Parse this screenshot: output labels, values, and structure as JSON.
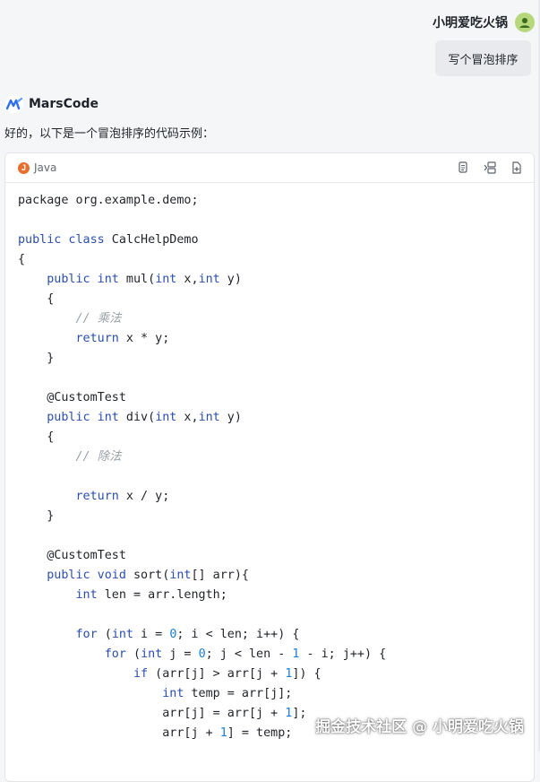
{
  "user": {
    "name": "小明爱吃火锅",
    "message": "写个冒泡排序"
  },
  "bot": {
    "name": "MarsCode",
    "intro": "好的，以下是一个冒泡排序的代码示例："
  },
  "code_block": {
    "language": "Java",
    "lines": [
      [
        {
          "t": "package org.example.demo;",
          "c": ""
        }
      ],
      [],
      [
        {
          "t": "public class",
          "c": "kw"
        },
        {
          "t": " CalcHelpDemo",
          "c": ""
        }
      ],
      [
        {
          "t": "{",
          "c": ""
        }
      ],
      [
        {
          "t": "    ",
          "c": ""
        },
        {
          "t": "public int",
          "c": "kw"
        },
        {
          "t": " mul(",
          "c": ""
        },
        {
          "t": "int",
          "c": "kw"
        },
        {
          "t": " x,",
          "c": ""
        },
        {
          "t": "int",
          "c": "kw"
        },
        {
          "t": " y)",
          "c": ""
        }
      ],
      [
        {
          "t": "    {",
          "c": ""
        }
      ],
      [
        {
          "t": "        ",
          "c": ""
        },
        {
          "t": "// 乘法",
          "c": "cm"
        }
      ],
      [
        {
          "t": "        ",
          "c": ""
        },
        {
          "t": "return",
          "c": "kw"
        },
        {
          "t": " x * y;",
          "c": ""
        }
      ],
      [
        {
          "t": "    }",
          "c": ""
        }
      ],
      [],
      [
        {
          "t": "    @CustomTest",
          "c": "ann"
        }
      ],
      [
        {
          "t": "    ",
          "c": ""
        },
        {
          "t": "public int",
          "c": "kw"
        },
        {
          "t": " div(",
          "c": ""
        },
        {
          "t": "int",
          "c": "kw"
        },
        {
          "t": " x,",
          "c": ""
        },
        {
          "t": "int",
          "c": "kw"
        },
        {
          "t": " y)",
          "c": ""
        }
      ],
      [
        {
          "t": "    {",
          "c": ""
        }
      ],
      [
        {
          "t": "        ",
          "c": ""
        },
        {
          "t": "// 除法",
          "c": "cm"
        }
      ],
      [],
      [
        {
          "t": "        ",
          "c": ""
        },
        {
          "t": "return",
          "c": "kw"
        },
        {
          "t": " x / y;",
          "c": ""
        }
      ],
      [
        {
          "t": "    }",
          "c": ""
        }
      ],
      [],
      [
        {
          "t": "    @CustomTest",
          "c": "ann"
        }
      ],
      [
        {
          "t": "    ",
          "c": ""
        },
        {
          "t": "public void",
          "c": "kw"
        },
        {
          "t": " sort(",
          "c": ""
        },
        {
          "t": "int",
          "c": "kw"
        },
        {
          "t": "[] arr){",
          "c": ""
        }
      ],
      [
        {
          "t": "        ",
          "c": ""
        },
        {
          "t": "int",
          "c": "kw"
        },
        {
          "t": " len = arr.length;",
          "c": ""
        }
      ],
      [],
      [
        {
          "t": "        ",
          "c": ""
        },
        {
          "t": "for",
          "c": "kw"
        },
        {
          "t": " (",
          "c": ""
        },
        {
          "t": "int",
          "c": "kw"
        },
        {
          "t": " i = ",
          "c": ""
        },
        {
          "t": "0",
          "c": "num"
        },
        {
          "t": "; i < len; i++) {",
          "c": ""
        }
      ],
      [
        {
          "t": "            ",
          "c": ""
        },
        {
          "t": "for",
          "c": "kw"
        },
        {
          "t": " (",
          "c": ""
        },
        {
          "t": "int",
          "c": "kw"
        },
        {
          "t": " j = ",
          "c": ""
        },
        {
          "t": "0",
          "c": "num"
        },
        {
          "t": "; j < len - ",
          "c": ""
        },
        {
          "t": "1",
          "c": "num"
        },
        {
          "t": " - i; j++) {",
          "c": ""
        }
      ],
      [
        {
          "t": "                ",
          "c": ""
        },
        {
          "t": "if",
          "c": "kw"
        },
        {
          "t": " (arr[j] > arr[j + ",
          "c": ""
        },
        {
          "t": "1",
          "c": "num"
        },
        {
          "t": "]) {",
          "c": ""
        }
      ],
      [
        {
          "t": "                    ",
          "c": ""
        },
        {
          "t": "int",
          "c": "kw"
        },
        {
          "t": " temp = arr[j];",
          "c": ""
        }
      ],
      [
        {
          "t": "                    arr[j] = arr[j + ",
          "c": ""
        },
        {
          "t": "1",
          "c": "num"
        },
        {
          "t": "];",
          "c": ""
        }
      ],
      [
        {
          "t": "                    arr[j + ",
          "c": ""
        },
        {
          "t": "1",
          "c": "num"
        },
        {
          "t": "] = temp;",
          "c": ""
        }
      ]
    ]
  },
  "watermark": "掘金技术社区 @ 小明爱吃火锅",
  "colors": {
    "keyword": "#2b4fb0",
    "number": "#1c7ed6",
    "comment": "#9aa0a8",
    "avatar": "#b6d77a",
    "java_icon": "#e76f2d"
  },
  "icons": [
    "user-avatar-icon",
    "marscode-logo-icon",
    "java-icon",
    "copy-icon",
    "insert-icon",
    "new-file-icon"
  ]
}
